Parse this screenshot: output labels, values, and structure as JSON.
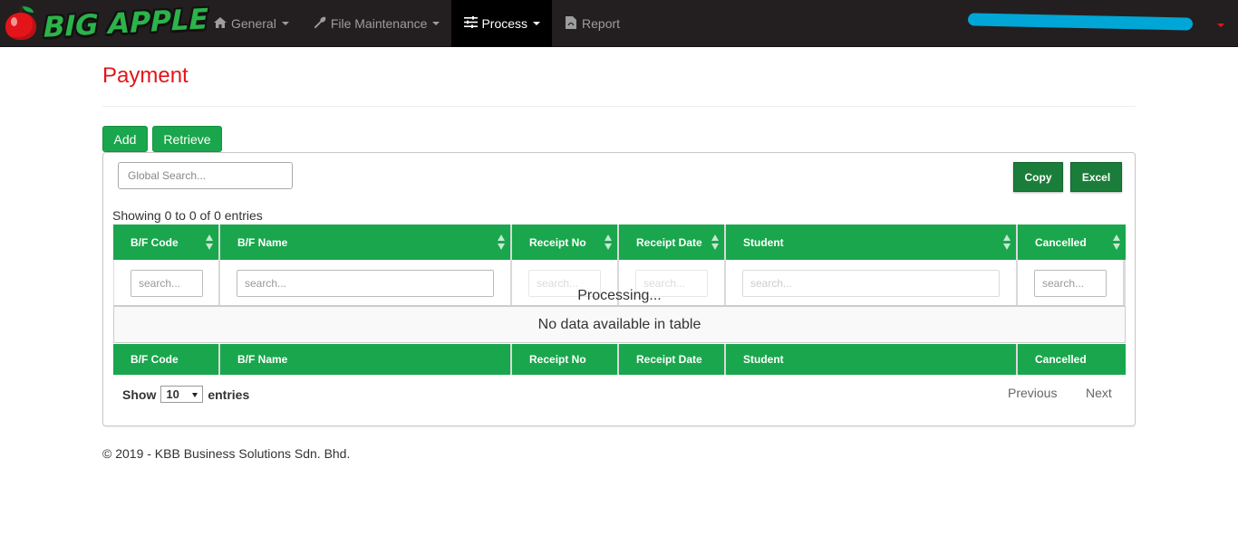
{
  "brand": {
    "name": "BIG APPLE"
  },
  "nav": {
    "items": [
      {
        "label": "General",
        "icon": "home-icon"
      },
      {
        "label": "File Maintenance",
        "icon": "wrench-icon"
      },
      {
        "label": "Process",
        "icon": "sliders-icon",
        "active": true
      },
      {
        "label": "Report",
        "icon": "file-pdf-icon"
      }
    ]
  },
  "page": {
    "title": "Payment"
  },
  "actions": {
    "add_label": "Add",
    "retrieve_label": "Retrieve"
  },
  "table": {
    "global_search_placeholder": "Global Search...",
    "copy_label": "Copy",
    "excel_label": "Excel",
    "info": "Showing 0 to 0 of 0 entries",
    "columns": [
      "B/F Code",
      "B/F Name",
      "Receipt No",
      "Receipt Date",
      "Student",
      "Cancelled"
    ],
    "column_search_placeholder": "search...",
    "processing": "Processing...",
    "empty_message": "No data available in table",
    "length_prefix": "Show",
    "length_value": "10",
    "length_suffix": "entries",
    "previous_label": "Previous",
    "next_label": "Next"
  },
  "colors": {
    "accent_green": "#1aa64c",
    "dark_green": "#1a7d3a",
    "title_red": "#e3151a",
    "navbar": "#231f20"
  },
  "footer": {
    "text": "© 2019 - KBB Business Solutions Sdn. Bhd."
  }
}
